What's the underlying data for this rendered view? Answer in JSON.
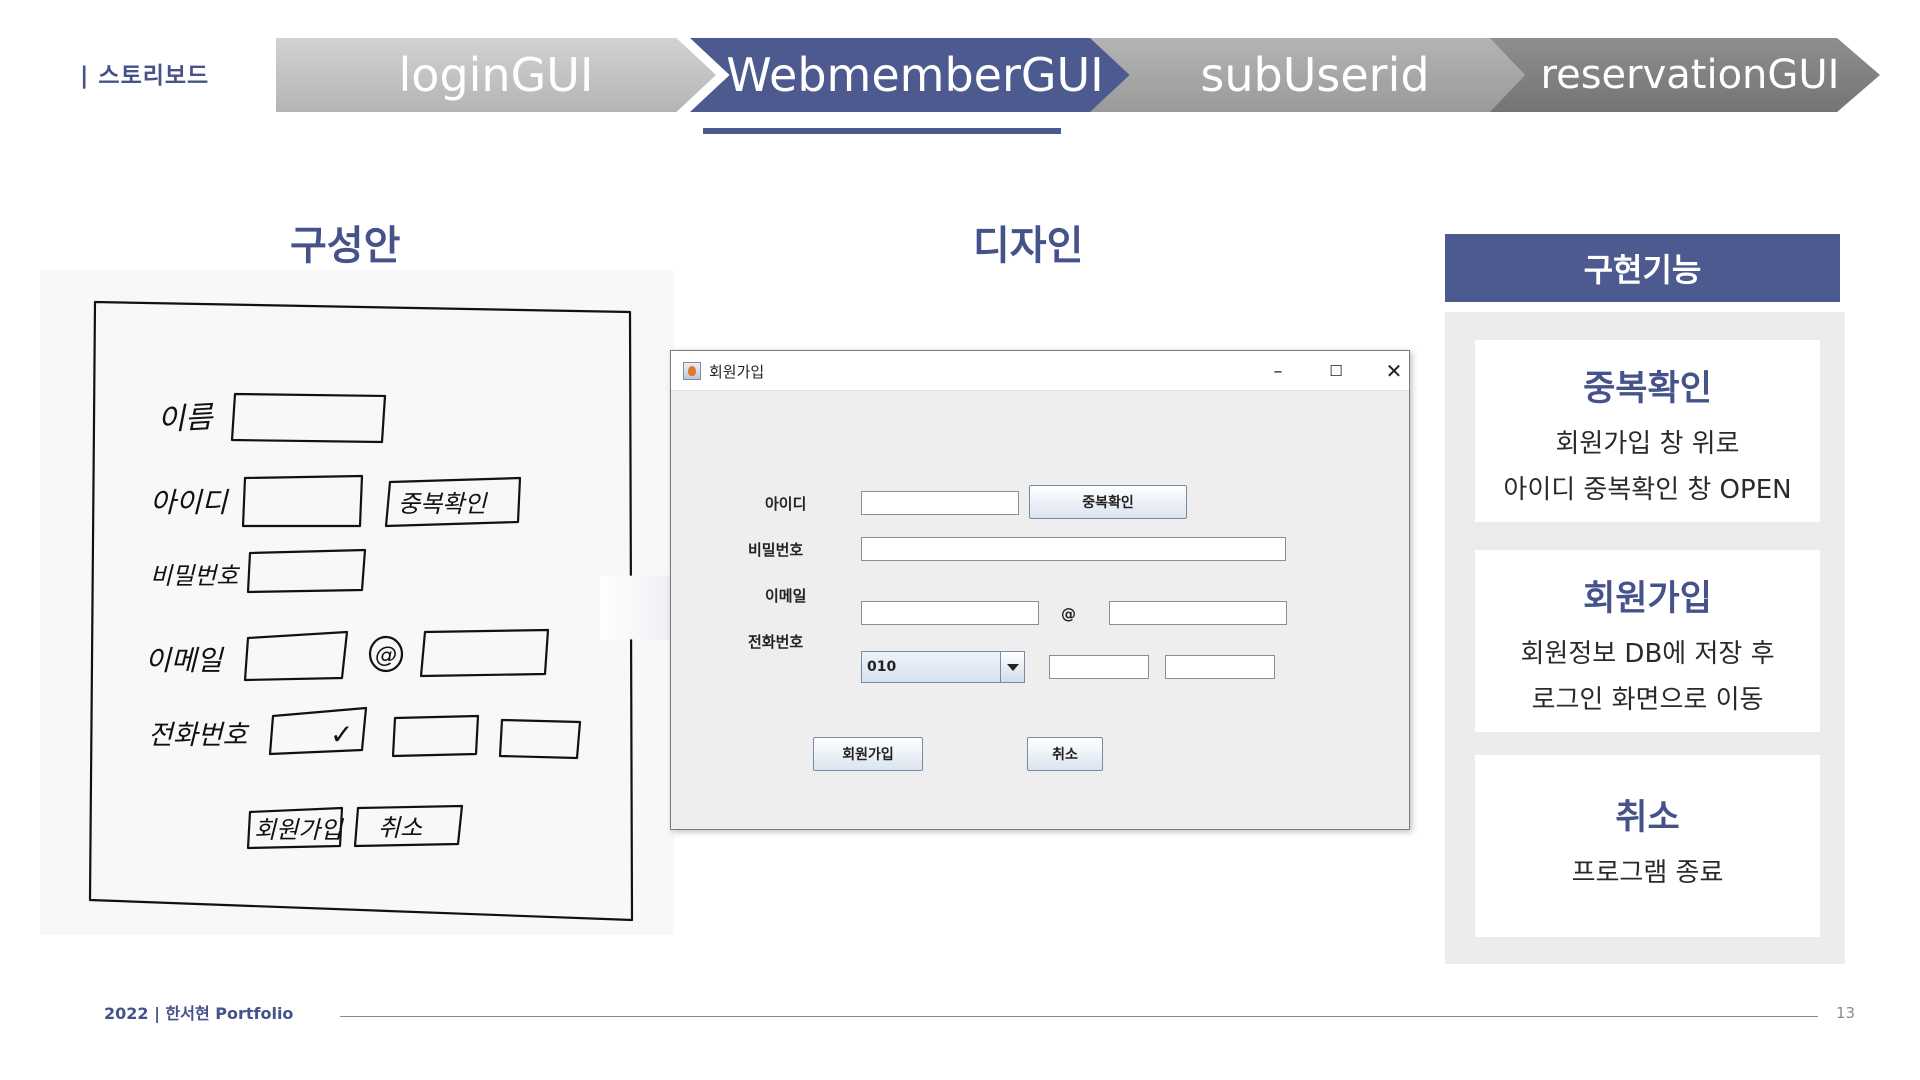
{
  "brand": "| 스토리보드",
  "steps": [
    "loginGUI",
    "WebmemberGUI",
    "subUserid",
    "reservationGUI"
  ],
  "active_step": "WebmemberGUI",
  "sections": {
    "concept": "구성안",
    "design": "디자인",
    "features": "구현기능"
  },
  "sketch": {
    "labels": [
      "이름",
      "아이디",
      "비밀번호",
      "이메일",
      "전화번호"
    ],
    "check_button": "중복확인",
    "at": "@",
    "check_mark": "✓",
    "buttons": [
      "회원가입",
      "취소"
    ]
  },
  "window": {
    "title": "회원가입",
    "controls": {
      "minimize": "–",
      "maximize": "☐",
      "close": "✕"
    },
    "labels": {
      "id": "아이디",
      "password": "비밀번호",
      "email": "이메일",
      "phone": "전화번호"
    },
    "check_button": "중복확인",
    "at": "@",
    "phone_prefix": "010",
    "signup_button": "회원가입",
    "cancel_button": "취소"
  },
  "features": [
    {
      "title": "중복확인",
      "lines": [
        "회원가입 창 위로",
        "아이디 중복확인 창 OPEN"
      ]
    },
    {
      "title": "회원가입",
      "lines": [
        "회원정보 DB에 저장 후",
        "로그인 화면으로 이동"
      ]
    },
    {
      "title": "취소",
      "lines": [
        "프로그램 종료"
      ]
    }
  ],
  "footer": {
    "text": "2022 | 한서현 Portfolio",
    "page": "13"
  },
  "colors": {
    "accent": "#4d5a8f",
    "panel": "#ececec",
    "title": "#46538a"
  }
}
